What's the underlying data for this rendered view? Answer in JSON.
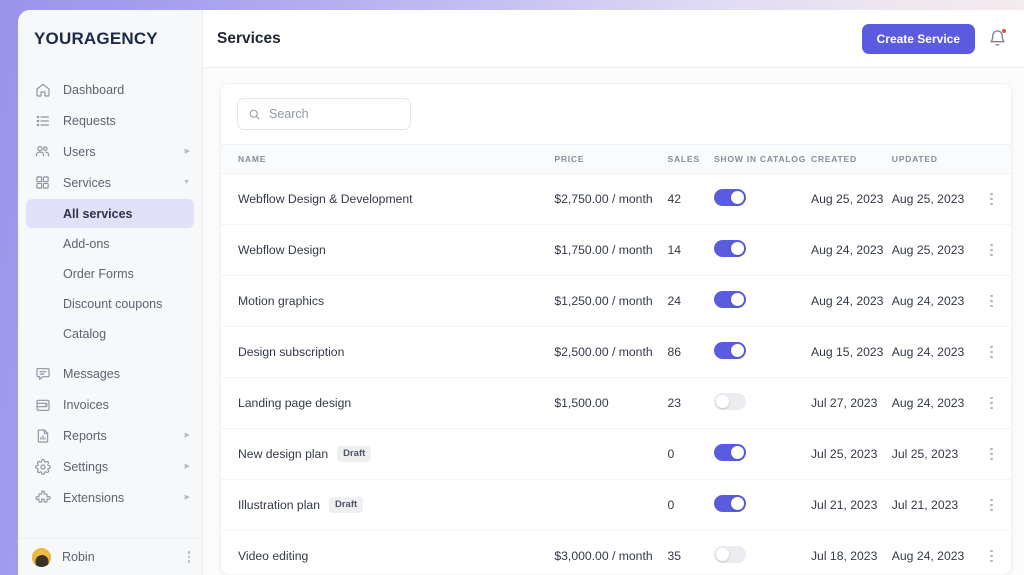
{
  "brand": {
    "name": "YOURAGENCY"
  },
  "sidebar": {
    "items": [
      {
        "label": "Dashboard",
        "icon": "home-icon",
        "expandable": false
      },
      {
        "label": "Requests",
        "icon": "list-icon",
        "expandable": false
      },
      {
        "label": "Users",
        "icon": "users-icon",
        "expandable": true
      },
      {
        "label": "Services",
        "icon": "grid-icon",
        "expandable": true,
        "expanded": true
      }
    ],
    "services_children": [
      {
        "label": "All services",
        "active": true
      },
      {
        "label": "Add-ons",
        "active": false
      },
      {
        "label": "Order Forms",
        "active": false
      },
      {
        "label": "Discount coupons",
        "active": false
      },
      {
        "label": "Catalog",
        "active": false
      }
    ],
    "items_lower": [
      {
        "label": "Messages",
        "icon": "chat-icon",
        "expandable": false
      },
      {
        "label": "Invoices",
        "icon": "wallet-icon",
        "expandable": false
      },
      {
        "label": "Reports",
        "icon": "report-icon",
        "expandable": true
      },
      {
        "label": "Settings",
        "icon": "gear-icon",
        "expandable": true
      },
      {
        "label": "Extensions",
        "icon": "puzzle-icon",
        "expandable": true
      }
    ],
    "user": {
      "name": "Robin"
    }
  },
  "topbar": {
    "title": "Services",
    "create_button": "Create Service",
    "notification_has_badge": true
  },
  "search": {
    "placeholder": "Search",
    "value": ""
  },
  "table": {
    "columns": [
      "NAME",
      "PRICE",
      "SALES",
      "SHOW IN CATALOG",
      "CREATED",
      "UPDATED"
    ],
    "rows": [
      {
        "name": "Webflow Design & Development",
        "badge": "",
        "price": "$2,750.00 / month",
        "sales": "42",
        "show_in_catalog": true,
        "created": "Aug 25, 2023",
        "updated": "Aug 25, 2023"
      },
      {
        "name": "Webflow Design",
        "badge": "",
        "price": "$1,750.00 / month",
        "sales": "14",
        "show_in_catalog": true,
        "created": "Aug 24, 2023",
        "updated": "Aug 25, 2023"
      },
      {
        "name": "Motion graphics",
        "badge": "",
        "price": "$1,250.00 / month",
        "sales": "24",
        "show_in_catalog": true,
        "created": "Aug 24, 2023",
        "updated": "Aug 24, 2023"
      },
      {
        "name": "Design subscription",
        "badge": "",
        "price": "$2,500.00 / month",
        "sales": "86",
        "show_in_catalog": true,
        "created": "Aug 15, 2023",
        "updated": "Aug 24, 2023"
      },
      {
        "name": "Landing page design",
        "badge": "",
        "price": "$1,500.00",
        "sales": "23",
        "show_in_catalog": false,
        "created": "Jul 27, 2023",
        "updated": "Aug 24, 2023"
      },
      {
        "name": "New design plan",
        "badge": "Draft",
        "price": "",
        "sales": "0",
        "show_in_catalog": true,
        "created": "Jul 25, 2023",
        "updated": "Jul 25, 2023"
      },
      {
        "name": "Illustration plan",
        "badge": "Draft",
        "price": "",
        "sales": "0",
        "show_in_catalog": true,
        "created": "Jul 21, 2023",
        "updated": "Jul 21, 2023"
      },
      {
        "name": "Video editing",
        "badge": "",
        "price": "$3,000.00 / month",
        "sales": "35",
        "show_in_catalog": false,
        "created": "Jul 18, 2023",
        "updated": "Aug 24, 2023"
      }
    ]
  },
  "colors": {
    "accent": "#5b5be0",
    "accent_soft": "#e3e1fa",
    "brand_text": "#1b2a4a",
    "toggle_off": "#ebecef",
    "badge_dot": "#ee4b3c",
    "sidebar_bg": "#f7f8f9"
  }
}
